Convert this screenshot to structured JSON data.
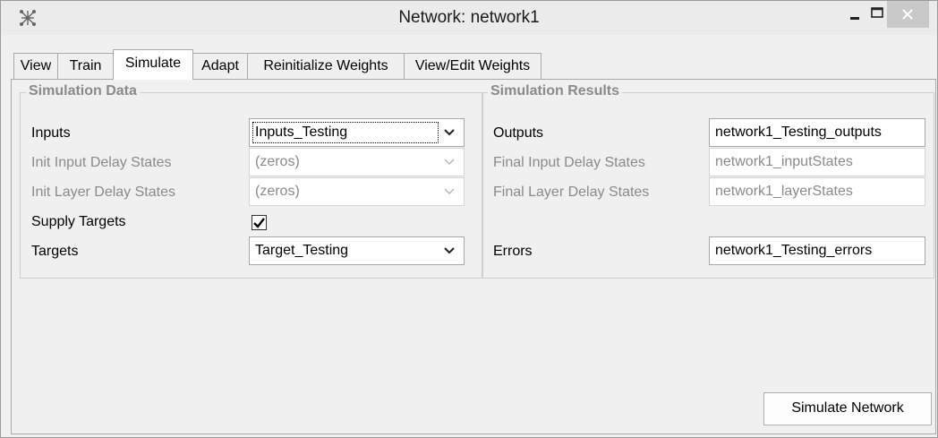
{
  "window": {
    "title": "Network: network1",
    "icon": "network-app-icon"
  },
  "tabs": [
    {
      "label": "View",
      "active": false
    },
    {
      "label": "Train",
      "active": false
    },
    {
      "label": "Simulate",
      "active": true
    },
    {
      "label": "Adapt",
      "active": false
    },
    {
      "label": "Reinitialize Weights",
      "active": false
    },
    {
      "label": "View/Edit Weights",
      "active": false
    }
  ],
  "simulation_data": {
    "title": "Simulation Data",
    "inputs": {
      "label": "Inputs",
      "value": "Inputs_Testing"
    },
    "init_input_delay": {
      "label": "Init Input Delay States",
      "value": "(zeros)"
    },
    "init_layer_delay": {
      "label": "Init Layer Delay States",
      "value": "(zeros)"
    },
    "supply_targets": {
      "label": "Supply Targets",
      "checked": true
    },
    "targets": {
      "label": "Targets",
      "value": "Target_Testing"
    }
  },
  "simulation_results": {
    "title": "Simulation Results",
    "outputs": {
      "label": "Outputs",
      "value": "network1_Testing_outputs"
    },
    "final_input_delay": {
      "label": "Final Input Delay States",
      "value": "network1_inputStates"
    },
    "final_layer_delay": {
      "label": "Final Layer Delay States",
      "value": "network1_layerStates"
    },
    "errors": {
      "label": "Errors",
      "value": "network1_Testing_errors"
    }
  },
  "actions": {
    "simulate_label": "Simulate Network"
  }
}
